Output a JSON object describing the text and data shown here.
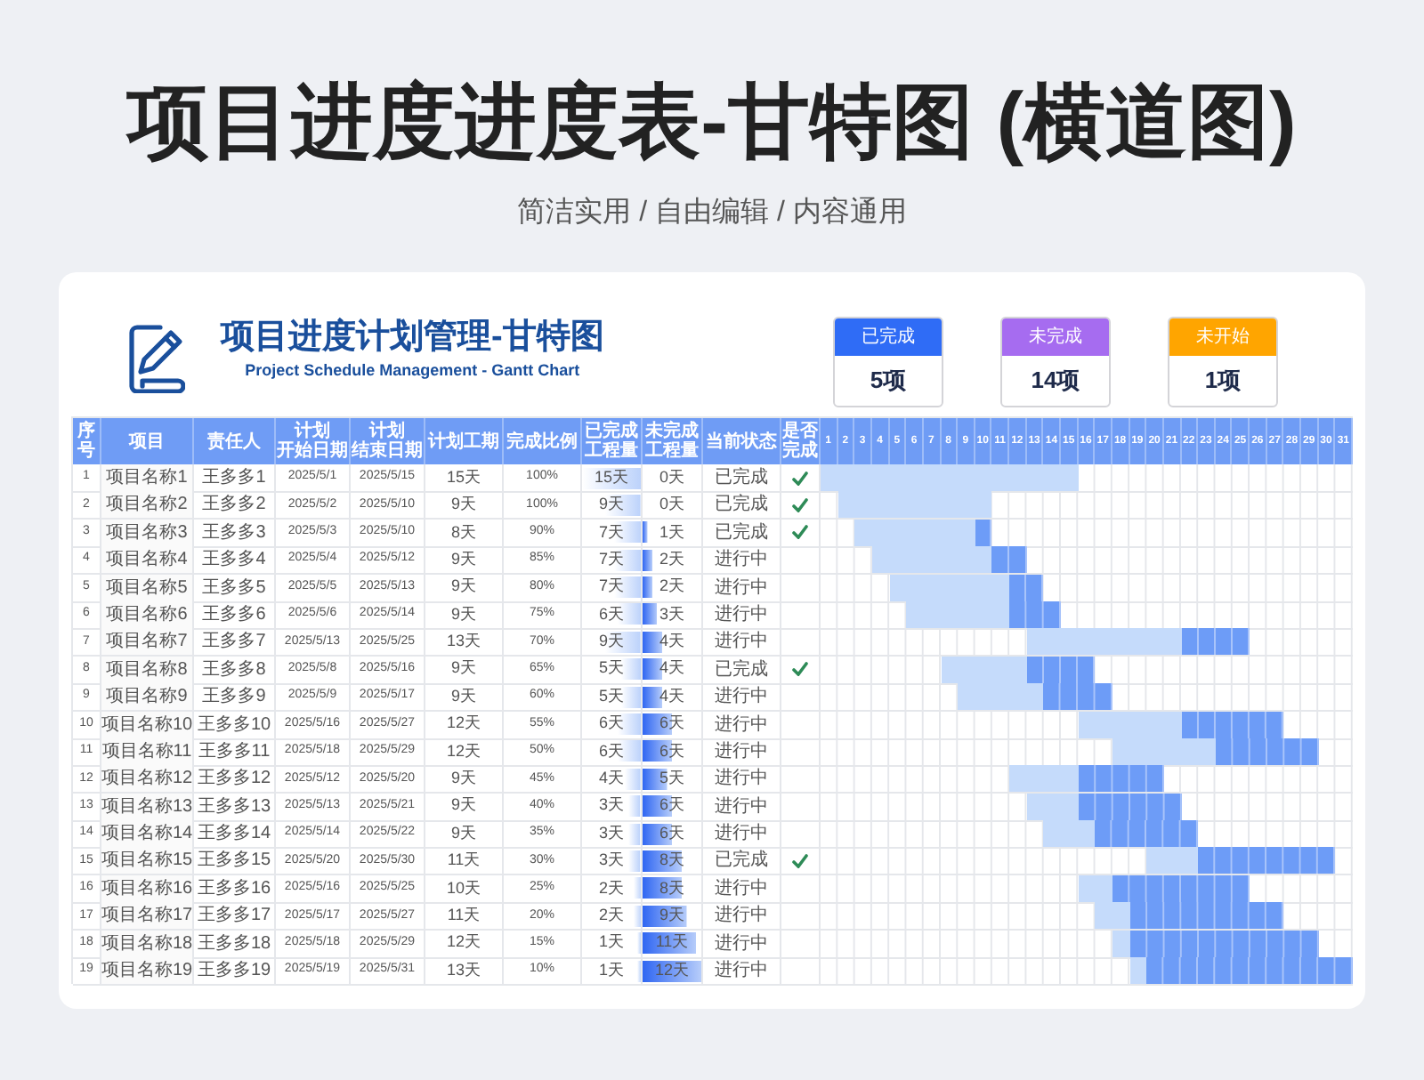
{
  "page": {
    "title": "项目进度进度表-甘特图 (横道图)",
    "subtitle": "简洁实用 / 自由编辑 / 内容通用"
  },
  "sheet": {
    "title": "项目进度计划管理-甘特图",
    "subtitle": "Project Schedule Management - Gantt Chart"
  },
  "summary": [
    {
      "label": "已完成",
      "value": "5项",
      "color": "#2f6cf6"
    },
    {
      "label": "未完成",
      "value": "14项",
      "color": "#a66cf0"
    },
    {
      "label": "未开始",
      "value": "1项",
      "color": "#ffa500"
    }
  ],
  "table": {
    "columns": [
      {
        "lines": [
          "序",
          "号"
        ]
      },
      {
        "lines": [
          "项目"
        ]
      },
      {
        "lines": [
          "责任人"
        ]
      },
      {
        "lines": [
          "计划",
          "开始日期"
        ]
      },
      {
        "lines": [
          "计划",
          "结束日期"
        ]
      },
      {
        "lines": [
          "计划工期"
        ]
      },
      {
        "lines": [
          "完成比例"
        ]
      },
      {
        "lines": [
          "已完成",
          "工程量"
        ]
      },
      {
        "lines": [
          "未完成",
          "工程量"
        ]
      },
      {
        "lines": [
          "当前状态"
        ]
      },
      {
        "lines": [
          "是否",
          "完成"
        ]
      }
    ],
    "days": [
      "1",
      "2",
      "3",
      "4",
      "5",
      "6",
      "7",
      "8",
      "9",
      "10",
      "11",
      "12",
      "13",
      "14",
      "15",
      "16",
      "17",
      "18",
      "19",
      "20",
      "21",
      "22",
      "23",
      "24",
      "25",
      "26",
      "27",
      "28",
      "29",
      "30",
      "31"
    ],
    "rows": [
      {
        "no": "1",
        "name": "项目名称1",
        "owner": "王多多1",
        "start": "2025/5/1",
        "end": "2025/5/15",
        "duration": "15天",
        "ratio": "100%",
        "done_qty": "15天",
        "remaining_qty": "0天",
        "status": "已完成",
        "done": true
      },
      {
        "no": "2",
        "name": "项目名称2",
        "owner": "王多多2",
        "start": "2025/5/2",
        "end": "2025/5/10",
        "duration": "9天",
        "ratio": "100%",
        "done_qty": "9天",
        "remaining_qty": "0天",
        "status": "已完成",
        "done": true
      },
      {
        "no": "3",
        "name": "项目名称3",
        "owner": "王多多3",
        "start": "2025/5/3",
        "end": "2025/5/10",
        "duration": "8天",
        "ratio": "90%",
        "done_qty": "7天",
        "remaining_qty": "1天",
        "status": "已完成",
        "done": true
      },
      {
        "no": "4",
        "name": "项目名称4",
        "owner": "王多多4",
        "start": "2025/5/4",
        "end": "2025/5/12",
        "duration": "9天",
        "ratio": "85%",
        "done_qty": "7天",
        "remaining_qty": "2天",
        "status": "进行中",
        "done": false
      },
      {
        "no": "5",
        "name": "项目名称5",
        "owner": "王多多5",
        "start": "2025/5/5",
        "end": "2025/5/13",
        "duration": "9天",
        "ratio": "80%",
        "done_qty": "7天",
        "remaining_qty": "2天",
        "status": "进行中",
        "done": false
      },
      {
        "no": "6",
        "name": "项目名称6",
        "owner": "王多多6",
        "start": "2025/5/6",
        "end": "2025/5/14",
        "duration": "9天",
        "ratio": "75%",
        "done_qty": "6天",
        "remaining_qty": "3天",
        "status": "进行中",
        "done": false
      },
      {
        "no": "7",
        "name": "项目名称7",
        "owner": "王多多7",
        "start": "2025/5/13",
        "end": "2025/5/25",
        "duration": "13天",
        "ratio": "70%",
        "done_qty": "9天",
        "remaining_qty": "4天",
        "status": "进行中",
        "done": false
      },
      {
        "no": "8",
        "name": "项目名称8",
        "owner": "王多多8",
        "start": "2025/5/8",
        "end": "2025/5/16",
        "duration": "9天",
        "ratio": "65%",
        "done_qty": "5天",
        "remaining_qty": "4天",
        "status": "已完成",
        "done": true
      },
      {
        "no": "9",
        "name": "项目名称9",
        "owner": "王多多9",
        "start": "2025/5/9",
        "end": "2025/5/17",
        "duration": "9天",
        "ratio": "60%",
        "done_qty": "5天",
        "remaining_qty": "4天",
        "status": "进行中",
        "done": false
      },
      {
        "no": "10",
        "name": "项目名称10",
        "owner": "王多多10",
        "start": "2025/5/16",
        "end": "2025/5/27",
        "duration": "12天",
        "ratio": "55%",
        "done_qty": "6天",
        "remaining_qty": "6天",
        "status": "进行中",
        "done": false
      },
      {
        "no": "11",
        "name": "项目名称11",
        "owner": "王多多11",
        "start": "2025/5/18",
        "end": "2025/5/29",
        "duration": "12天",
        "ratio": "50%",
        "done_qty": "6天",
        "remaining_qty": "6天",
        "status": "进行中",
        "done": false
      },
      {
        "no": "12",
        "name": "项目名称12",
        "owner": "王多多12",
        "start": "2025/5/12",
        "end": "2025/5/20",
        "duration": "9天",
        "ratio": "45%",
        "done_qty": "4天",
        "remaining_qty": "5天",
        "status": "进行中",
        "done": false
      },
      {
        "no": "13",
        "name": "项目名称13",
        "owner": "王多多13",
        "start": "2025/5/13",
        "end": "2025/5/21",
        "duration": "9天",
        "ratio": "40%",
        "done_qty": "3天",
        "remaining_qty": "6天",
        "status": "进行中",
        "done": false
      },
      {
        "no": "14",
        "name": "项目名称14",
        "owner": "王多多14",
        "start": "2025/5/14",
        "end": "2025/5/22",
        "duration": "9天",
        "ratio": "35%",
        "done_qty": "3天",
        "remaining_qty": "6天",
        "status": "进行中",
        "done": false
      },
      {
        "no": "15",
        "name": "项目名称15",
        "owner": "王多多15",
        "start": "2025/5/20",
        "end": "2025/5/30",
        "duration": "11天",
        "ratio": "30%",
        "done_qty": "3天",
        "remaining_qty": "8天",
        "status": "已完成",
        "done": true
      },
      {
        "no": "16",
        "name": "项目名称16",
        "owner": "王多多16",
        "start": "2025/5/16",
        "end": "2025/5/25",
        "duration": "10天",
        "ratio": "25%",
        "done_qty": "2天",
        "remaining_qty": "8天",
        "status": "进行中",
        "done": false
      },
      {
        "no": "17",
        "name": "项目名称17",
        "owner": "王多多17",
        "start": "2025/5/17",
        "end": "2025/5/27",
        "duration": "11天",
        "ratio": "20%",
        "done_qty": "2天",
        "remaining_qty": "9天",
        "status": "进行中",
        "done": false
      },
      {
        "no": "18",
        "name": "项目名称18",
        "owner": "王多多18",
        "start": "2025/5/18",
        "end": "2025/5/29",
        "duration": "12天",
        "ratio": "15%",
        "done_qty": "1天",
        "remaining_qty": "11天",
        "status": "进行中",
        "done": false
      },
      {
        "no": "19",
        "name": "项目名称19",
        "owner": "王多多19",
        "start": "2025/5/19",
        "end": "2025/5/31",
        "duration": "13天",
        "ratio": "10%",
        "done_qty": "1天",
        "remaining_qty": "12天",
        "status": "进行中",
        "done": false
      }
    ]
  }
}
